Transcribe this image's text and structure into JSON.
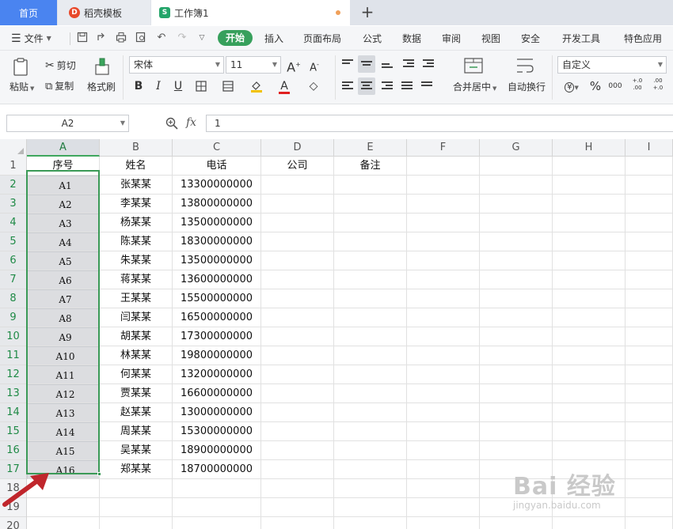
{
  "tabs": {
    "home": "首页",
    "template": "稻壳模板",
    "workbook": "工作簿1",
    "new_tab": "+"
  },
  "menu": {
    "file": "文件",
    "start": "开始",
    "items": [
      "插入",
      "页面布局",
      "公式",
      "数据",
      "审阅",
      "视图",
      "安全",
      "开发工具",
      "特色应用"
    ]
  },
  "ribbon": {
    "paste": "粘贴",
    "cut": "剪切",
    "copy": "复制",
    "format_painter": "格式刷",
    "font_name": "宋体",
    "font_size": "11",
    "increase_font": "A",
    "decrease_font": "A",
    "bold": "B",
    "italic": "I",
    "underline": "U",
    "font_color_letter": "A",
    "merge_center": "合并居中",
    "wrap_text": "自动换行",
    "number_format": "自定义",
    "currency": "¥",
    "percent": "%",
    "thousands": "000",
    "inc_decimal": "+.0 .00",
    "dec_decimal": ".00 +.0"
  },
  "formula_bar": {
    "name_box": "A2",
    "fx": "fx",
    "value": "1"
  },
  "grid": {
    "columns": [
      "A",
      "B",
      "C",
      "D",
      "E",
      "F",
      "G",
      "H",
      "I"
    ],
    "active_column": "A",
    "row_numbers": [
      "1",
      "2",
      "3",
      "4",
      "5",
      "6",
      "7",
      "8",
      "9",
      "10",
      "11",
      "12",
      "13",
      "14",
      "15",
      "16",
      "17",
      "18",
      "19",
      "20"
    ],
    "headers": [
      "序号",
      "姓名",
      "电话",
      "公司",
      "备注"
    ],
    "rows": [
      [
        "A1",
        "张某某",
        "13300000000"
      ],
      [
        "A2",
        "李某某",
        "13800000000"
      ],
      [
        "A3",
        "杨某某",
        "13500000000"
      ],
      [
        "A4",
        "陈某某",
        "18300000000"
      ],
      [
        "A5",
        "朱某某",
        "13500000000"
      ],
      [
        "A6",
        "蒋某某",
        "13600000000"
      ],
      [
        "A7",
        "王某某",
        "15500000000"
      ],
      [
        "A8",
        "闫某某",
        "16500000000"
      ],
      [
        "A9",
        "胡某某",
        "17300000000"
      ],
      [
        "A10",
        "林某某",
        "19800000000"
      ],
      [
        "A11",
        "何某某",
        "13200000000"
      ],
      [
        "A12",
        "贾某某",
        "16600000000"
      ],
      [
        "A13",
        "赵某某",
        "13000000000"
      ],
      [
        "A14",
        "周某某",
        "15300000000"
      ],
      [
        "A15",
        "吴某某",
        "18900000000"
      ],
      [
        "A16",
        "郑某某",
        "18700000000"
      ]
    ]
  },
  "colors": {
    "accent_green": "#3b9a57",
    "tab_blue": "#4a84f0",
    "arrow_red": "#c0262c"
  },
  "watermark": {
    "logo": "Bai 经验",
    "url": "jingyan.baidu.com"
  }
}
